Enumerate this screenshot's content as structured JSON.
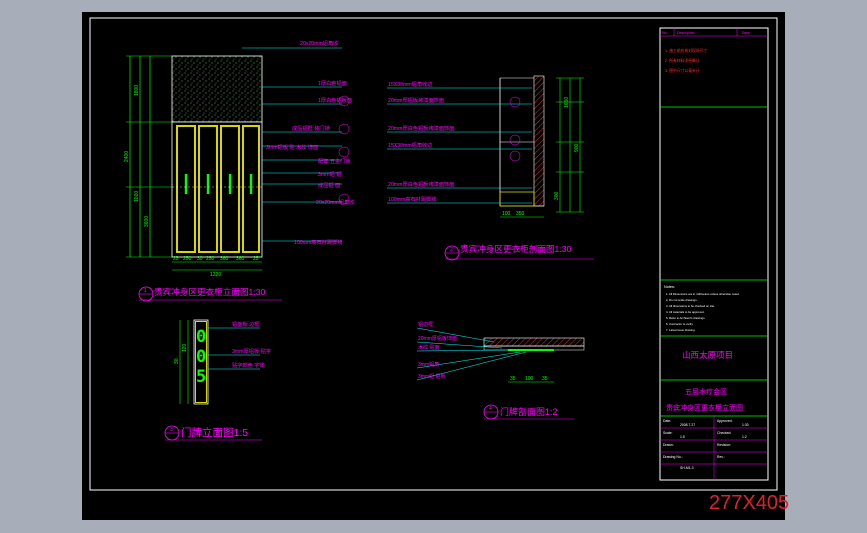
{
  "watermark": "277X405",
  "colors": {
    "background": "#000000",
    "frame": "#ffffff",
    "label": "#ff00ff",
    "dimension": "#00ff00",
    "leader": "#00ffff",
    "title_block": "#ff00ff",
    "block_divider": "#00ff00",
    "notes_red": "#ff3030",
    "hatch_green": "#3a8a3a",
    "panel_yellow": "#d8d800"
  },
  "elevation": {
    "title": "贵宾冲身区更衣柜立面图1:30",
    "number": "1",
    "labels": [
      "20x20mm铝角收",
      "1厚白色铝面",
      "1厚白色铝板面",
      "成品铝框 装门锁",
      "3mm铝板 贴 木纹 饰面",
      "配套 五金门锁",
      "3mm铝 铝",
      "成品铝 面",
      "20x20mm铝角收",
      "100mm高石材踢脚线"
    ],
    "dims_left": [
      "1800",
      "2400",
      "1020",
      "3600"
    ],
    "dims_bottom": [
      "25",
      "250",
      "30",
      "250",
      "360",
      "360",
      "25"
    ],
    "dims_total": [
      "1220"
    ]
  },
  "section": {
    "title": "贵宾冲身区更衣柜剖面图1:30",
    "number": "2",
    "labels": [
      "15X30mm铝角收边",
      "20mm厚铝板烤漆面饰面",
      "20mm厚白色铝板烤漆面饰面",
      "15X30mm铝角收边",
      "20mm厚白色铝板烤漆面饰面",
      "100mm高石材踢脚线"
    ],
    "dims_right": [
      "1650",
      "900",
      "300"
    ],
    "dims_bottom": [
      "100",
      "350"
    ]
  },
  "plaque_elevation": {
    "title": "门牌立面图1:5",
    "number": "3",
    "digits": [
      "0",
      "0",
      "5"
    ],
    "labels": [
      "铝面板 边框",
      "3mm厚铝板 贴字",
      "贴字颜色 字体"
    ],
    "dims": [
      "30",
      "120"
    ]
  },
  "plaque_section": {
    "title": "门牌剖面图1:2",
    "number": "4",
    "labels": [
      "铝边框",
      "20mm厚铝板饰面",
      "木纹 贴面",
      "3mm铝角",
      "3mm铝 铝板"
    ],
    "dims": [
      "35",
      "100",
      "35"
    ]
  },
  "title_block": {
    "header": [
      "No.",
      "Description",
      "Date"
    ],
    "notes_red": [
      "1. 施工前应核对现场尺寸",
      "2. 所有材料须经确认",
      "3. 图中尺寸以毫米计"
    ],
    "notes_heading": "Notes:",
    "notes": [
      "1. All Dimensions are in millimetres unless otherwise noted.",
      "2. Do not scale drawings.",
      "3. All dimensions to be checked on site.",
      "4. All materials to be approved.",
      "5. Refer to Architect's drawings.",
      "6. Contractor to verify.",
      "7. Latest issue drawing."
    ],
    "project": "山西太原项目",
    "area": "五层水疗会区",
    "drawing_title": "贵宾冲身区更衣柜立面图",
    "fields": [
      {
        "label": "Date:",
        "value": "2008.7.27"
      },
      {
        "label": "Approved:",
        "value": "1:30"
      },
      {
        "label": "Scale:",
        "value": "1:5"
      },
      {
        "label": "Checked:",
        "value": "1:2"
      },
      {
        "label": "Drawn:",
        "value": ""
      },
      {
        "label": "Revision:",
        "value": ""
      },
      {
        "label": "Drawing No.:",
        "value": "SH-M1-3"
      },
      {
        "label": "Rev.:",
        "value": ""
      }
    ]
  }
}
